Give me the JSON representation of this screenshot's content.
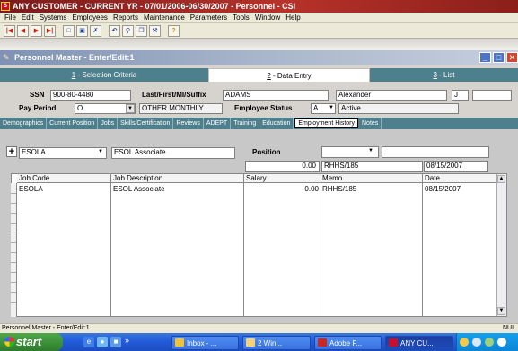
{
  "app": {
    "logo_text": "S",
    "title": "ANY CUSTOMER - CURRENT YR - 07/01/2006-06/30/2007 - Personnel - CSI"
  },
  "menu": [
    "File",
    "Edit",
    "Systems",
    "Employees",
    "Reports",
    "Maintenance",
    "Parameters",
    "Tools",
    "Window",
    "Help"
  ],
  "toolbar": {
    "icons": [
      "first-record-icon",
      "previous-record-icon",
      "next-record-icon",
      "last-record-icon",
      "new-record-icon",
      "save-icon",
      "delete-icon",
      "undo-icon",
      "find-icon",
      "copy-icon",
      "tools-icon",
      "help-icon"
    ]
  },
  "child_window": {
    "title": "Personnel Master - Enter/Edit:1"
  },
  "main_tabs": {
    "selection": {
      "num": "1",
      "label": " - Selection Criteria"
    },
    "entry": {
      "num": "2",
      "label": " - Data Entry"
    },
    "list": {
      "num": "3",
      "label": " - List"
    }
  },
  "employee": {
    "ssn_label": "SSN",
    "ssn": "900-80-4480",
    "name_label": "Last/First/MI/Suffix",
    "last": "ADAMS",
    "first": "Alexander",
    "mi": "J",
    "suffix": "",
    "pay_period_label": "Pay Period",
    "pay_period_code": "O",
    "pay_period_desc": "OTHER MONTHLY",
    "status_label": "Employee Status",
    "status_code": "A",
    "status_desc": "Active"
  },
  "sub_tabs": [
    "Demographics",
    "Current Position",
    "Jobs",
    "Skills/Certification",
    "Reviews",
    "ADEPT",
    "Training",
    "Education",
    "Employment History",
    "Notes"
  ],
  "active_sub_tab": "Employment History",
  "entry_form": {
    "job_code": "ESOLA",
    "job_desc": "ESOL Associate",
    "position_label": "Position",
    "position_value": "",
    "position_extra": "",
    "salary": "0.00",
    "memo": "RHHS/185",
    "date": "08/15/2007"
  },
  "grid": {
    "columns": [
      "Job Code",
      "Job Description",
      "Salary",
      "Memo",
      "Date"
    ],
    "rows": [
      [
        "ESOLA",
        "ESOL Associate",
        "0.00",
        "RHHS/185",
        "08/15/2007"
      ]
    ]
  },
  "status_bar": {
    "text": "Personnel Master - Enter/Edit:1",
    "num": "NUI"
  },
  "taskbar": {
    "start_label": "start",
    "tasks": [
      {
        "label": "Inbox - ...",
        "color": "#f1c232"
      },
      {
        "label": "2 Win...",
        "color": "#f4d27a"
      },
      {
        "label": "Adobe F...",
        "color": "#c62828"
      },
      {
        "label": "ANY CU...",
        "color": "#c8102e"
      }
    ]
  },
  "colors": {
    "title_red": "#b7322a",
    "tab_teal": "#4e7f8c",
    "child_title": "#7f92b3",
    "taskbar_blue": "#245edc",
    "start_green": "#3a8e37"
  }
}
